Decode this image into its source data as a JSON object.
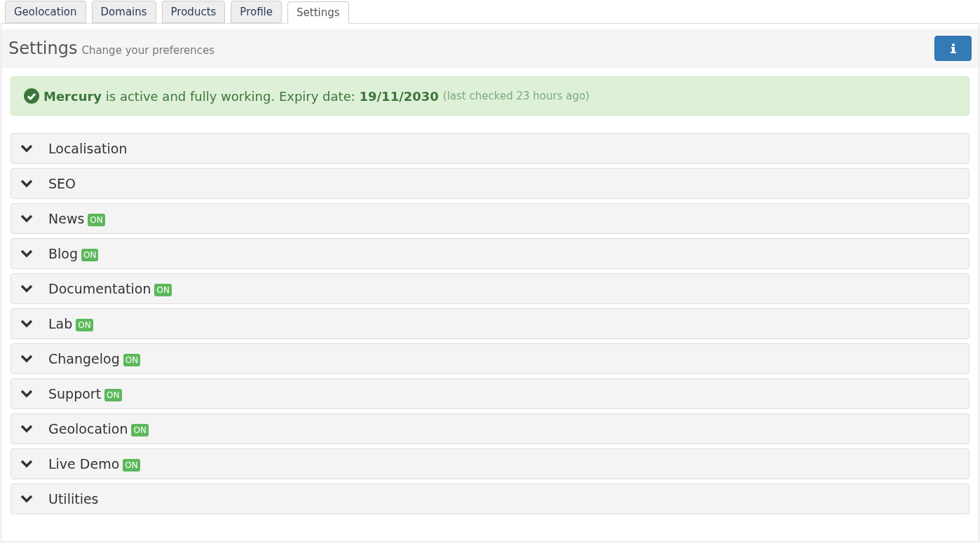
{
  "tabs": [
    {
      "label": "Geolocation",
      "selected": false
    },
    {
      "label": "Domains",
      "selected": false
    },
    {
      "label": "Products",
      "selected": false
    },
    {
      "label": "Profile",
      "selected": false
    },
    {
      "label": "Settings",
      "selected": true
    }
  ],
  "header": {
    "title": "Settings",
    "subtitle": "Change your preferences"
  },
  "alert": {
    "message": "**Mercury** is active and fully working. Expiry date: **19/11/2030**",
    "note": "(last checked 23 hours ago)"
  },
  "sections": [
    {
      "label": "Localisation",
      "expanded": false
    },
    {
      "label": "SEO",
      "expanded": false
    },
    {
      "label": "News",
      "expanded": false,
      "badge": "ON"
    },
    {
      "label": "Blog",
      "expanded": false,
      "badge": "ON"
    },
    {
      "label": "Documentation",
      "expanded": false,
      "badge": "ON"
    },
    {
      "label": "Lab",
      "expanded": false,
      "badge": "ON"
    },
    {
      "label": "Changelog",
      "expanded": false,
      "badge": "ON"
    },
    {
      "label": "Support",
      "expanded": false,
      "badge": "ON"
    },
    {
      "label": "Geolocation",
      "expanded": false,
      "badge": "ON"
    },
    {
      "label": "Live Demo",
      "expanded": false,
      "badge": "ON"
    },
    {
      "label": "Utilities",
      "expanded": false
    }
  ]
}
